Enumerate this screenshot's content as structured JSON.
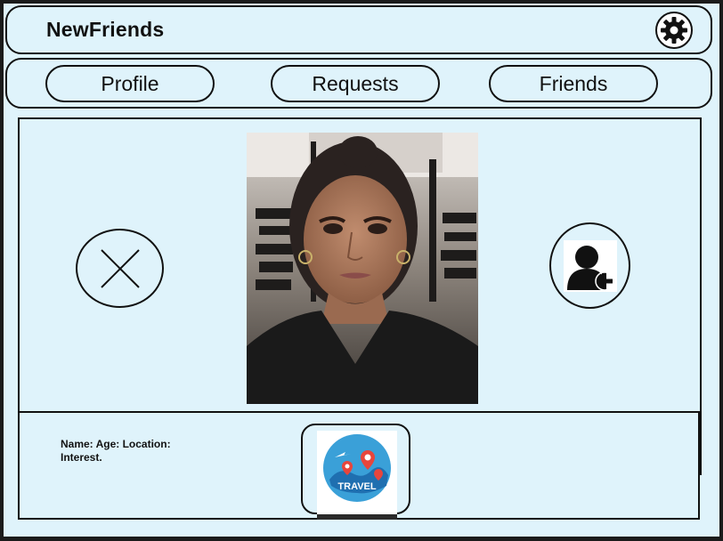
{
  "header": {
    "app_title": "NewFriends",
    "settings_icon": "gear-icon"
  },
  "nav": {
    "tabs": [
      {
        "label": "Profile"
      },
      {
        "label": "Requests"
      },
      {
        "label": "Friends"
      }
    ]
  },
  "profile_card": {
    "reject_icon": "close-x-icon",
    "add_icon": "add-friend-icon"
  },
  "info": {
    "fields": "Name: Age: Location:",
    "interest_label": "Interest.",
    "interest_image_text": "TRAVEL"
  },
  "colors": {
    "background": "#dff3fb",
    "border": "#111111",
    "travel_circle": "#3aa0d8",
    "pin": "#e8453c"
  }
}
